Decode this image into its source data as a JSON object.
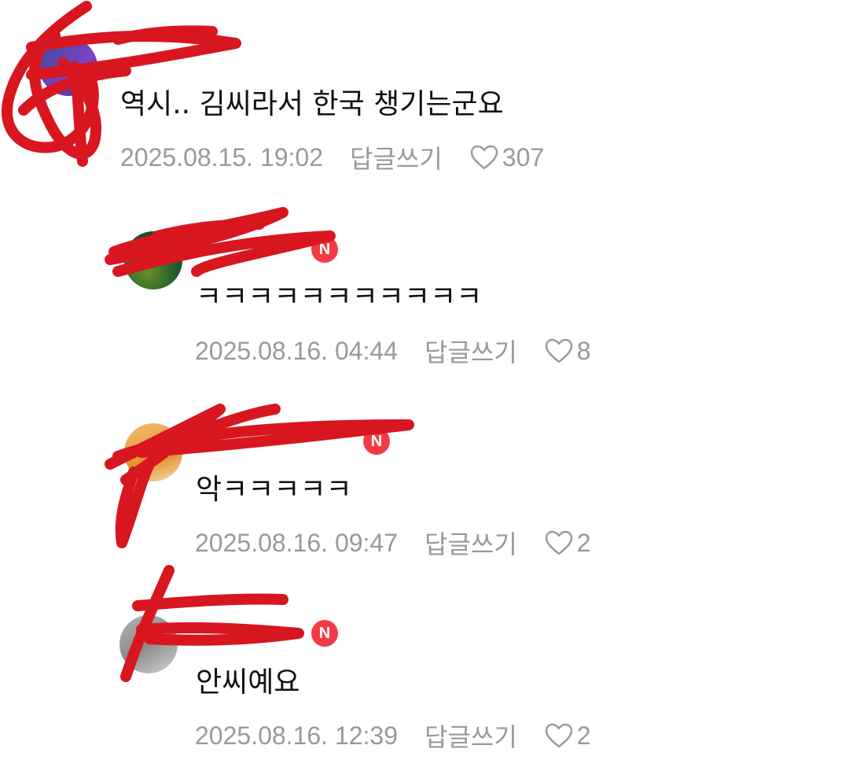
{
  "comments": [
    {
      "author": "",
      "badge": "",
      "text": "역시.. 김씨라서 한국 챙기는군요",
      "date": "2025.08.15. 19:02",
      "reply_label": "답글쓰기",
      "likes": "307",
      "avatar_icon": "user-avatar"
    },
    {
      "author": "",
      "badge": "N",
      "text": "ㅋㅋㅋㅋㅋㅋㅋㅋㅋㅋㅋ",
      "date": "2025.08.16. 04:44",
      "reply_label": "답글쓰기",
      "likes": "8",
      "avatar_icon": "user-avatar"
    },
    {
      "author": "",
      "badge": "N",
      "text": "악ㅋㅋㅋㅋㅋ",
      "date": "2025.08.16. 09:47",
      "reply_label": "답글쓰기",
      "likes": "2",
      "avatar_icon": "user-avatar"
    },
    {
      "author": "",
      "badge": "N",
      "text": "안씨예요",
      "date": "2025.08.16. 12:39",
      "reply_label": "답글쓰기",
      "likes": "2",
      "avatar_icon": "user-avatar"
    }
  ],
  "colors": {
    "badge": "#f23c45",
    "meta_text": "#999999",
    "body_text": "#111111",
    "redaction": "#d8161f"
  },
  "icons": {
    "like": "heart-outline-icon",
    "badge": "new-badge-icon"
  }
}
